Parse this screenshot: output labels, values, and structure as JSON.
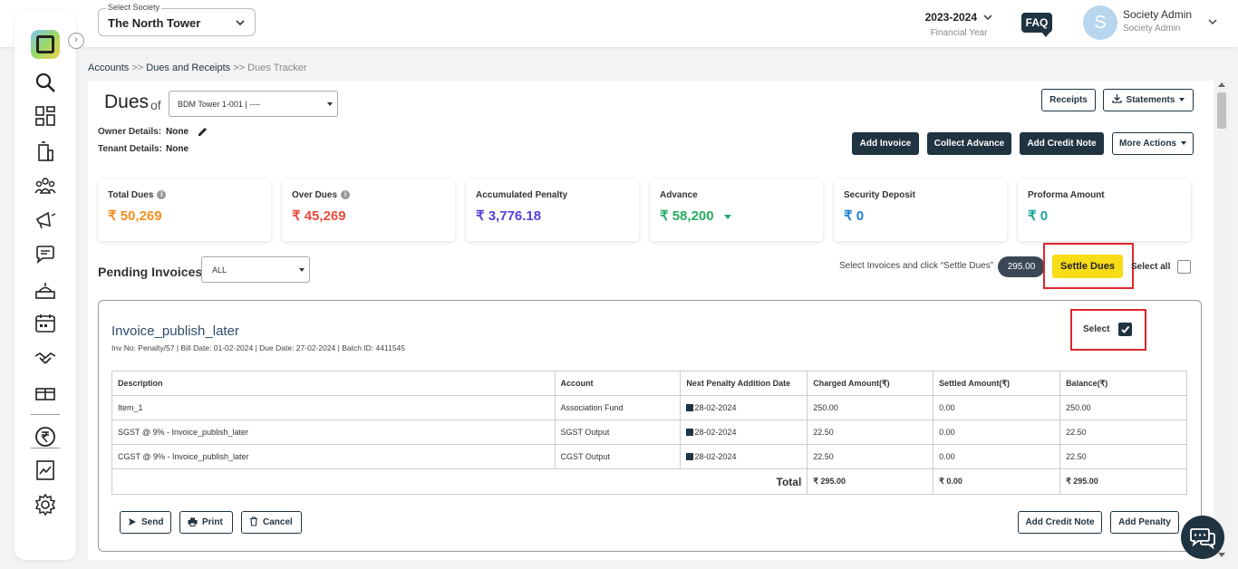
{
  "header": {
    "society_label": "Select Society",
    "society_value": "The North Tower",
    "financial_year": "2023-2024",
    "financial_year_label": "Financial Year",
    "faq": "FAQ",
    "avatar_letter": "S",
    "user_name": "Society Admin",
    "user_role": "Society Admin"
  },
  "sidebar": {
    "icons": [
      "search-icon",
      "dashboard-icon",
      "building-icon",
      "members-icon",
      "megaphone-icon",
      "chat-icon",
      "helpdesk-icon",
      "calendar-icon",
      "handshake-icon",
      "parking-icon",
      "rupee-icon",
      "reports-icon",
      "gear-icon"
    ]
  },
  "breadcrumb": {
    "accounts": "Accounts",
    "sep1": ">>",
    "dues_receipts": "Dues and Receipts",
    "sep2": ">>",
    "current": "Dues Tracker"
  },
  "dues": {
    "title": "Dues",
    "of": "of",
    "flat_value": "BDM Tower 1-001 | ----",
    "owner_label": "Owner Details:",
    "owner_value": "None",
    "tenant_label": "Tenant Details:",
    "tenant_value": "None"
  },
  "actions": {
    "receipts": "Receipts",
    "statements": "Statements",
    "add_invoice": "Add Invoice",
    "collect_advance": "Collect Advance",
    "add_credit_note": "Add Credit Note",
    "more_actions": "More Actions"
  },
  "summary": [
    {
      "title": "Total Dues",
      "value": "₹ 50,269",
      "color": "#f0901e"
    },
    {
      "title": "Over Dues",
      "value": "₹ 45,269",
      "color": "#e84c3d"
    },
    {
      "title": "Accumulated Penalty",
      "value": "₹ 3,776.18",
      "color": "#5a3fd6"
    },
    {
      "title": "Advance",
      "value": "₹ 58,200",
      "color": "#27ae60"
    },
    {
      "title": "Security Deposit",
      "value": "₹ 0",
      "color": "#1d7ed8"
    },
    {
      "title": "Proforma Amount",
      "value": "₹ 0",
      "color": "#1aa39b"
    }
  ],
  "pending": {
    "title": "Pending Invoices",
    "filter": "ALL",
    "hint": "Select Invoices and click “Settle Dues”",
    "selected_amount": "295.00",
    "settle_button": "Settle Dues",
    "select_all": "Select all"
  },
  "invoice": {
    "title": "Invoice_publish_later",
    "meta": "Inv No: Penalty/57 | Bill Date: 01-02-2024 | Due Date: 27-02-2024 | Batch ID: 4411545",
    "select_label": "Select",
    "selected": true,
    "columns": [
      "Description",
      "Account",
      "Next Penalty Addition Date",
      "Charged Amount(₹)",
      "Settled Amount(₹)",
      "Balance(₹)"
    ],
    "rows": [
      [
        "Item_1",
        "Association Fund",
        "28-02-2024",
        "250.00",
        "0.00",
        "250.00"
      ],
      [
        "SGST @ 9% - Invoice_publish_later",
        "SGST Output",
        "28-02-2024",
        "22.50",
        "0.00",
        "22.50"
      ],
      [
        "CGST @ 9% - Invoice_publish_later",
        "CGST Output",
        "28-02-2024",
        "22.50",
        "0.00",
        "22.50"
      ]
    ],
    "total_label": "Total",
    "total_charged": "₹ 295.00",
    "total_settled": "₹ 0.00",
    "total_balance": "₹ 295.00"
  },
  "invoice_actions": {
    "send": "Send",
    "print": "Print",
    "cancel": "Cancel",
    "add_credit_note": "Add Credit Note",
    "add_penalty": "Add Penalty"
  }
}
